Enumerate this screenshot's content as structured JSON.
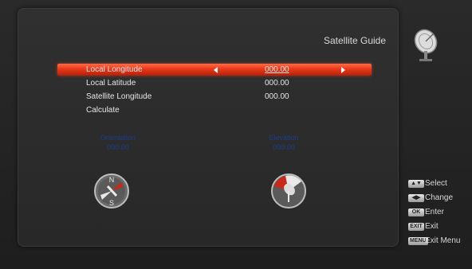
{
  "screen": {
    "title": "Satellite Guide"
  },
  "menu": {
    "items": [
      {
        "label": "Local Longitude",
        "value": "000.00",
        "selected": true
      },
      {
        "label": "Local Latitude",
        "value": "000.00",
        "selected": false
      },
      {
        "label": "Satellite Longitude",
        "value": "000.00",
        "selected": false
      },
      {
        "label": "Calculate",
        "value": "",
        "selected": false
      }
    ]
  },
  "results": {
    "orientation": {
      "label": "Orientation",
      "value": "000.00"
    },
    "elevation": {
      "label": "Elevation",
      "value": "000.00"
    }
  },
  "legend": [
    {
      "key": "▲▼",
      "icon": "up-down-key-icon",
      "text": "Select"
    },
    {
      "key": "◀▶",
      "icon": "left-right-key-icon",
      "text": "Change"
    },
    {
      "key": "OK",
      "icon": "ok-key-icon",
      "text": "Enter"
    },
    {
      "key": "EXIT",
      "icon": "exit-key-icon",
      "text": "Exit"
    },
    {
      "key": "MENU",
      "icon": "menu-key-icon",
      "text": "Exit Menu"
    }
  ],
  "colors": {
    "highlight": "#e8391a",
    "result_text": "#1a3f8a",
    "text": "#e6e6e6"
  }
}
